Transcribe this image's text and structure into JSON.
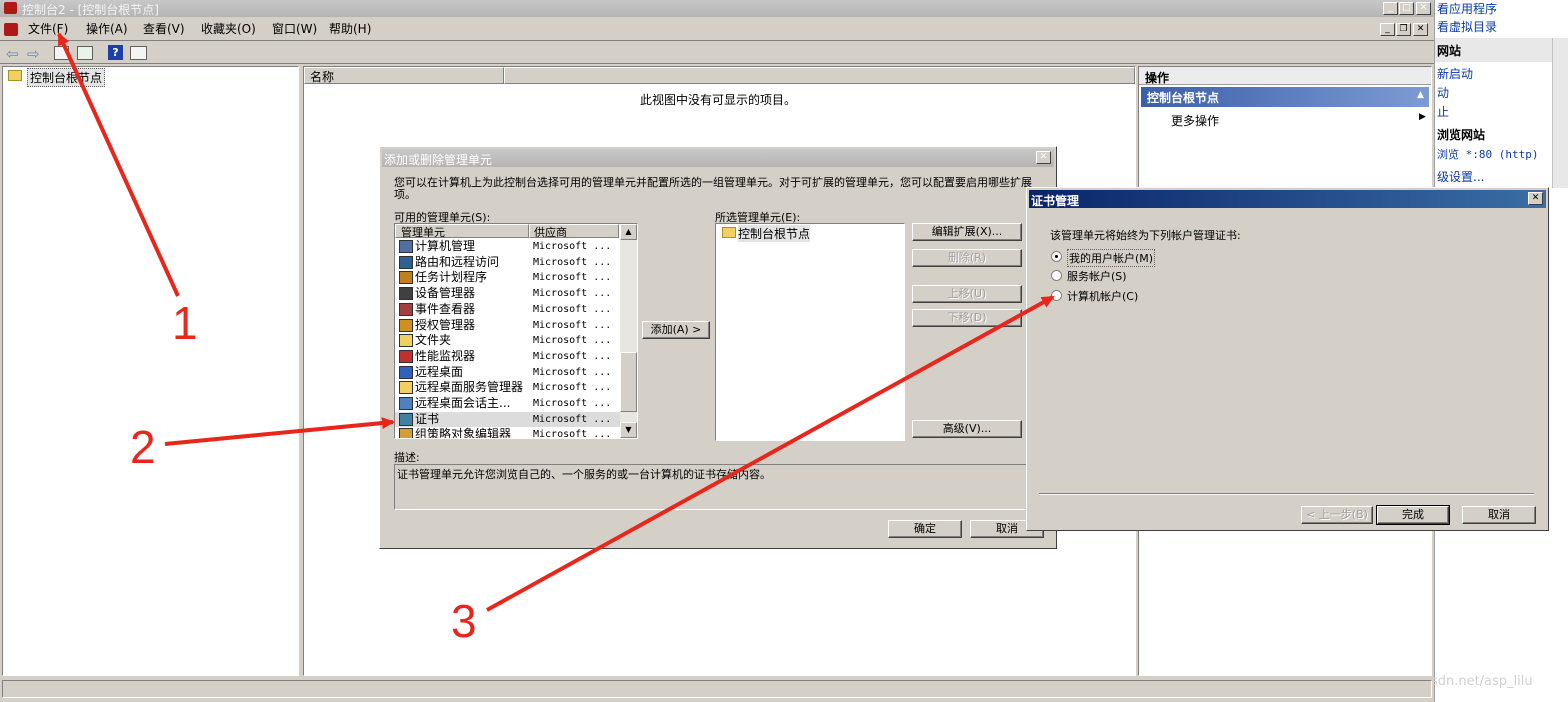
{
  "main_window": {
    "title": "控制台2 - [控制台根节点]",
    "menu": [
      "文件(F)",
      "操作(A)",
      "查看(V)",
      "收藏夹(O)",
      "窗口(W)",
      "帮助(H)"
    ],
    "tree_root": "控制台根节点",
    "list_column_name": "名称",
    "empty_message": "此视图中没有可显示的项目。",
    "actions_title": "操作",
    "actions_section": "控制台根节点",
    "actions_more": "更多操作"
  },
  "background_panel": {
    "lines": [
      "看应用程序",
      "看虚拟目录",
      "网站",
      "新启动",
      "动",
      "止",
      "浏览网站",
      "浏览 *:80 (http)",
      "级设置..."
    ]
  },
  "add_remove_dialog": {
    "title": "添加或删除管理单元",
    "description_text": "您可以在计算机上为此控制台选择可用的管理单元并配置所选的一组管理单元。对于可扩展的管理单元，您可以配置要启用哪些扩展项。",
    "available_label": "可用的管理单元(S):",
    "col_snapin": "管理单元",
    "col_vendor": "供应商",
    "snapins": [
      {
        "name": "计算机管理",
        "vendor": "Microsoft ..."
      },
      {
        "name": "路由和远程访问",
        "vendor": "Microsoft ..."
      },
      {
        "name": "任务计划程序",
        "vendor": "Microsoft ..."
      },
      {
        "name": "设备管理器",
        "vendor": "Microsoft ..."
      },
      {
        "name": "事件查看器",
        "vendor": "Microsoft ..."
      },
      {
        "name": "授权管理器",
        "vendor": "Microsoft ..."
      },
      {
        "name": "文件夹",
        "vendor": "Microsoft ..."
      },
      {
        "name": "性能监视器",
        "vendor": "Microsoft ..."
      },
      {
        "name": "远程桌面",
        "vendor": "Microsoft ..."
      },
      {
        "name": "远程桌面服务管理器",
        "vendor": "Microsoft ..."
      },
      {
        "name": "远程桌面会话主...",
        "vendor": "Microsoft ..."
      },
      {
        "name": "证书",
        "vendor": "Microsoft ..."
      },
      {
        "name": "组策略对象编辑器",
        "vendor": "Microsoft ..."
      }
    ],
    "add_button": "添加(A) >",
    "selected_label": "所选管理单元(E):",
    "selected_items": [
      "控制台根节点"
    ],
    "edit_ext_button": "编辑扩展(X)...",
    "remove_button": "删除(R)",
    "move_up_button": "上移(U)",
    "move_down_button": "下移(D)",
    "advanced_button": "高级(V)...",
    "desc_label": "描述:",
    "desc_value": "证书管理单元允许您浏览自己的、一个服务的或一台计算机的证书存储内容。",
    "ok_button": "确定",
    "cancel_button": "取消"
  },
  "cert_dialog": {
    "title": "证书管理",
    "prompt": "该管理单元将始终为下列帐户管理证书:",
    "options": [
      {
        "label": "我的用户帐户(M)",
        "checked": true
      },
      {
        "label": "服务帐户(S)",
        "checked": false
      },
      {
        "label": "计算机帐户(C)",
        "checked": false
      }
    ],
    "back_button": "< 上一步(B)",
    "finish_button": "完成",
    "cancel_button": "取消"
  },
  "annotations": {
    "step1": "1",
    "step2": "2",
    "step3": "3",
    "watermark": "https://blog.csdn.net/asp_lilu"
  },
  "colors": {
    "arrow": "#e8261b",
    "active_title": "#0a246a",
    "system_face": "#d4d0c8"
  }
}
